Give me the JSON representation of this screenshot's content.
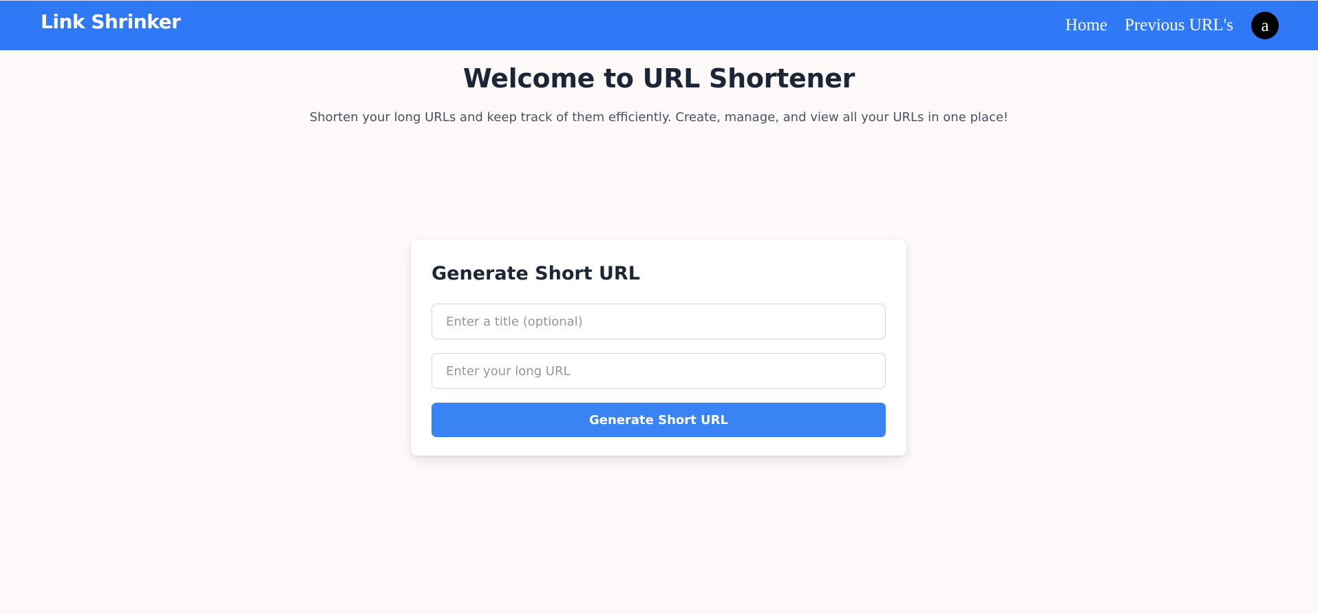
{
  "navbar": {
    "brand": "Link Shrinker",
    "links": [
      {
        "label": "Home"
      },
      {
        "label": "Previous URL's"
      }
    ],
    "avatar_letter": "a"
  },
  "hero": {
    "title": "Welcome to URL Shortener",
    "subtitle": "Shorten your long URLs and keep track of them efficiently. Create, manage, and view all your URLs in one place!"
  },
  "form": {
    "heading": "Generate Short URL",
    "title_field": {
      "value": "",
      "placeholder": "Enter a title (optional)"
    },
    "url_field": {
      "value": "",
      "placeholder": "Enter your long URL"
    },
    "submit_label": "Generate Short URL"
  },
  "colors": {
    "navbar_bg": "#2f78f6",
    "button_bg": "#3a83f4",
    "page_bg": "#fdf9f8",
    "heading_text": "#1c2637"
  }
}
